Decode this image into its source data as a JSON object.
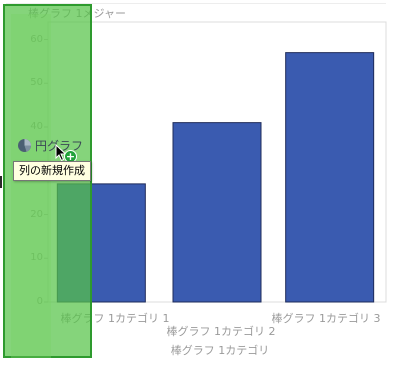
{
  "chart": {
    "title": "棒グラフ 1メジャー"
  },
  "chart_data": {
    "type": "bar",
    "title": "棒グラフ 1メジャー",
    "xlabel": "棒グラフ 1カテゴリ",
    "ylabel": "",
    "categories": [
      "棒グラフ 1カテゴリ 1",
      "棒グラフ 1カテゴリ 2",
      "棒グラフ 1カテゴリ 3"
    ],
    "values": [
      27,
      41,
      57
    ],
    "ylim": [
      0,
      64
    ],
    "yticks": [
      0,
      10,
      20,
      30,
      40,
      50,
      60
    ],
    "grid": false,
    "bar_color": "#3a5bb0",
    "bar_border": "#1e2b5a"
  },
  "drag": {
    "item_label": "円グラフ",
    "item_icon": "pie-chart-icon",
    "tooltip": "列の新規作成",
    "badge_icon": "plus-icon",
    "drop_zone_color": "#56c448"
  }
}
